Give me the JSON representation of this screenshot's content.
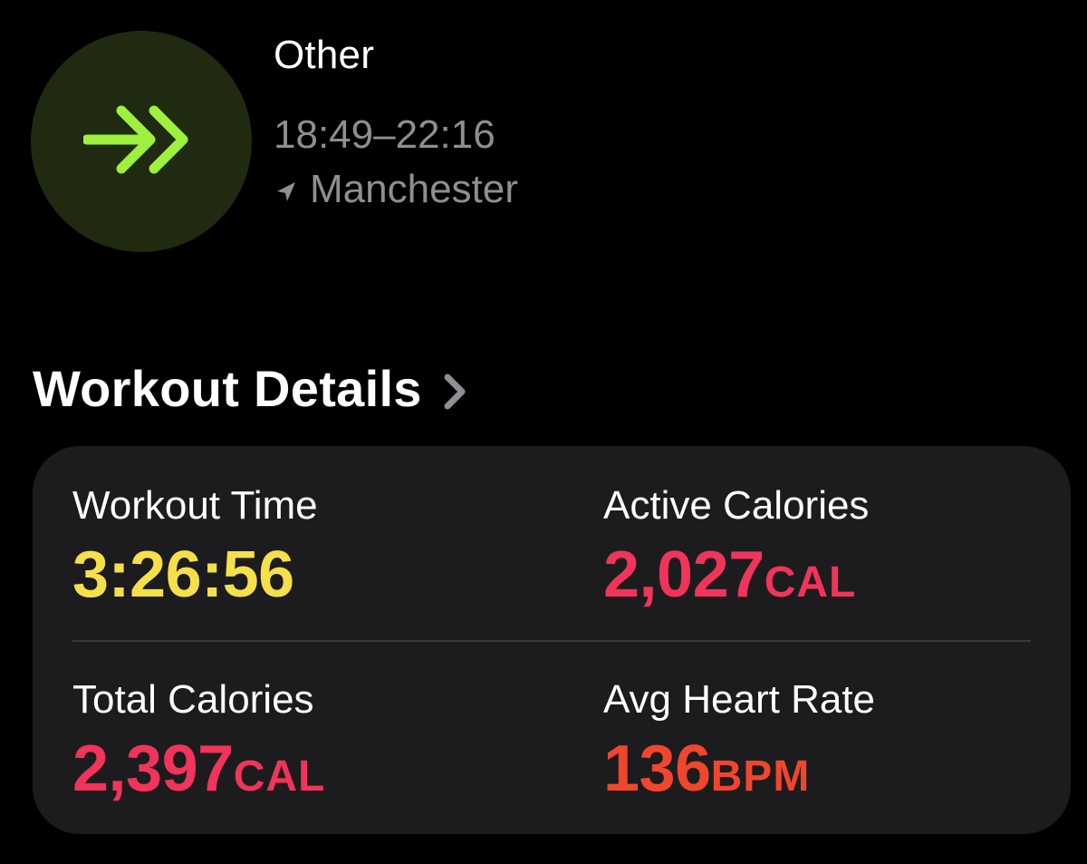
{
  "header": {
    "activity_type": "Other",
    "time_range": "18:49–22:16",
    "location": "Manchester",
    "workout_icon": "double-chevron-right-icon",
    "location_icon": "location-arrow-icon"
  },
  "section": {
    "title": "Workout Details",
    "chevron_icon": "chevron-right-icon"
  },
  "metrics": {
    "workout_time": {
      "label": "Workout Time",
      "value": "3:26:56",
      "unit": "",
      "color": "#f5e04a"
    },
    "active_calories": {
      "label": "Active Calories",
      "value": "2,027",
      "unit": "CAL",
      "color": "#f0345a"
    },
    "total_calories": {
      "label": "Total Calories",
      "value": "2,397",
      "unit": "CAL",
      "color": "#f0345a"
    },
    "avg_heart_rate": {
      "label": "Avg Heart Rate",
      "value": "136",
      "unit": "BPM",
      "color": "#f0462e"
    }
  },
  "colors": {
    "accent_green": "#9df03c",
    "icon_bg": "#1f2a10",
    "secondary_text": "#8e8e93",
    "card_bg": "#1c1c1e"
  }
}
